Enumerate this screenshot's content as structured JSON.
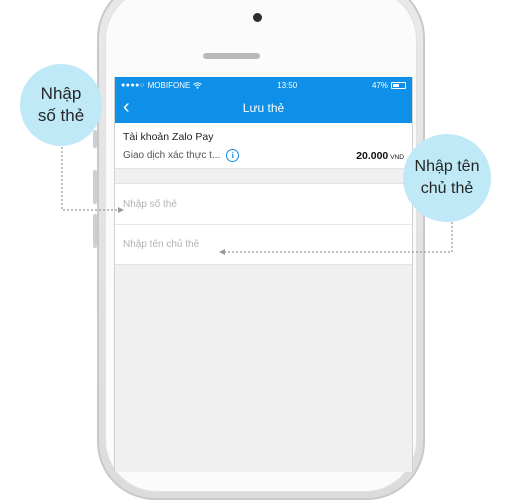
{
  "status_bar": {
    "carrier": "MOBIFONE",
    "time": "13:50",
    "battery": "47%"
  },
  "nav": {
    "title": "Lưu thẻ",
    "back_icon": "chevron-left-icon"
  },
  "account": {
    "title": "Tài khoản Zalo Pay",
    "desc": "Giao dịch xác thực t...",
    "amount": "20.000",
    "currency": "VND"
  },
  "fields": {
    "card_number_placeholder": "Nhập số thẻ",
    "card_holder_placeholder": "Nhập tên chủ thẻ"
  },
  "callouts": {
    "card_number_line1": "Nhập",
    "card_number_line2": "số thẻ",
    "card_holder_line1": "Nhập tên",
    "card_holder_line2": "chủ thẻ"
  },
  "colors": {
    "accent": "#0e8fe8",
    "bubble": "#bfe9f7"
  }
}
